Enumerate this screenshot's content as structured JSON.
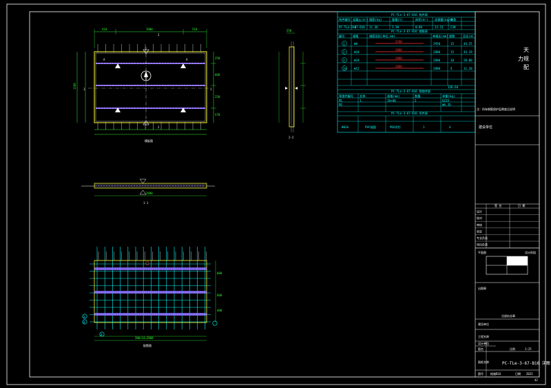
{
  "page_number": "42",
  "drawing": {
    "plan_title": "模板图",
    "plan_dims_top": [
      "410",
      "1900",
      "510"
    ],
    "plan_dims_side": [
      "1180",
      "250",
      "600",
      "250",
      "570"
    ],
    "plan_label_A": "A",
    "section_marker_1": "1",
    "section_marker_2": "2",
    "elevation_title": "1-1",
    "elevation_dim": "2890",
    "side_section_title": "2-2",
    "rebar_title": "配筋图",
    "rebar_bottom_dim": "200×14=2800",
    "rebar_side_dims": [
      "1900",
      "600",
      "600",
      "400"
    ],
    "rebar_tags": [
      "①",
      "②",
      "③"
    ]
  },
  "tables": {
    "component_title": "PC-TLe-3-67-B16 构件表",
    "component_headers": [
      "构件编号",
      "混凝土(m³)",
      "钢筋(kg)",
      "重量(t)",
      "体积(m³)",
      "含钢量(kg/m³)",
      "备注"
    ],
    "component_row": [
      "PC-TLe-3-67-B16",
      "18",
      "11.36",
      "2.30",
      "0.86",
      "13.21",
      "C30"
    ],
    "rebar_title": "PC-TLe-3-67-B16 钢筋表",
    "rebar_headers": [
      "编号",
      "规格",
      "钢筋形状(单位:mm)",
      "单根长(mm)",
      "根数",
      "总长(m)"
    ],
    "rebar_rows": [
      {
        "no": "1",
        "spec": "Φ8",
        "shape": "2590",
        "len": "2950",
        "count": "15",
        "total": "44.25"
      },
      {
        "no": "2",
        "spec": "Φ10",
        "shape": "2800",
        "len": "2800",
        "count": "15",
        "total": "43.19"
      },
      {
        "no": "3",
        "spec": "Φ10",
        "shape": "2800",
        "len": "2800",
        "count": "10",
        "total": "28.00"
      },
      {
        "no": "3a",
        "spec": "Φ12",
        "shape": "2800",
        "len": "2800",
        "count": "4",
        "total": "11.20"
      }
    ],
    "rebar_total": "126.64",
    "embed_title": "PC-TLe-3-67-B16 预埋件表",
    "embed_headers": [
      "预埋件编号",
      "名称",
      "规格(mm)",
      "数量",
      "单重(kg)"
    ],
    "embed_rows": [
      [
        "M1",
        "1",
        "16×60",
        "2",
        "Q235"
      ],
      [
        "M2",
        "",
        "",
        "",
        "Φ6.35"
      ]
    ],
    "lift_title": "PC-TLe-3-67-B16 吊件表",
    "lift_row": [
      "B016",
      "PVC锚固",
      "M16吊钉",
      "1",
      "4"
    ]
  },
  "title_block": {
    "side_text_1": "天",
    "side_text_2": "力规",
    "side_text_3": "配",
    "note_line": "注：所有钢筋保护层厚度见说明",
    "stamp_label": "建设单位",
    "sig_headers": [
      "签 名",
      "日 期"
    ],
    "sig_rows": [
      "设计",
      "校对",
      "审核",
      "审定",
      "专业负责",
      "项目负责"
    ],
    "grid_label": "平面图",
    "grid_label_right": "设计阶段",
    "seal_label": "出图章",
    "seal_sub": "注册执业章",
    "project_label": "建设单位",
    "sub_label": "工程名称",
    "design_unit": "设计单位",
    "drawing_name_label": "图名",
    "scale_label": "比例",
    "scale_value": "1:25",
    "sheet_title_label": "图纸名称",
    "sheet_title": "PC-TLe-3-67-B16 详图",
    "sheet_no_label": "图号",
    "sheet_no": "结施B16",
    "date_label": "日期",
    "date_value": "2022"
  }
}
